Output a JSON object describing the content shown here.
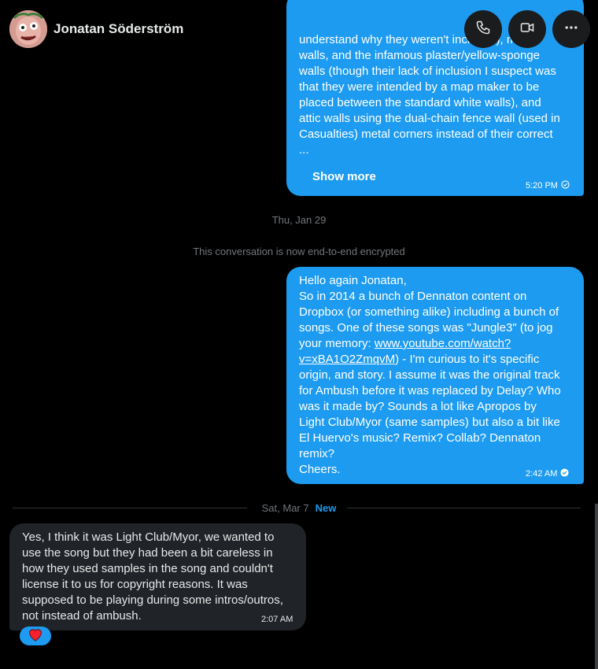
{
  "header": {
    "contact_name": "Jonatan Söderström",
    "avatar_icon": "avatar-illustration",
    "buttons": {
      "call_icon": "phone-icon",
      "video_icon": "video-camera-icon",
      "more_icon": "more-horizontal-icon"
    }
  },
  "messages": [
    {
      "direction": "outgoing",
      "text_partial": "understand why they weren't included), metal\nwalls, and the infamous plaster/yellow-sponge\nwalls (though their lack of inclusion I suspect was\nthat they were intended by a map maker to be\nplaced between the standard white walls), and\nattic walls using the dual-chain fence wall (used in\nCasualties) metal corners instead of their correct\n...",
      "show_more_label": "Show more",
      "time": "5:20 PM",
      "status_icon": "sent-check-icon"
    },
    {
      "direction": "outgoing",
      "text_before_link": "Hello again Jonatan,\nSo in 2014 a bunch of Dennaton content on\nDropbox (or something alike) including a bunch of\nsongs. One of these songs was \"Jungle3\"  (to jog\nyour memory: ",
      "link_text": "www.youtube.com/watch?\nv=xBA1O2ZmqvM",
      "text_after_link": ") - I'm curious to it's specific\norigin, and story. I assume it was the original track\nfor Ambush before it was replaced by Delay? Who\nwas it made by? Sounds a lot like Apropos by\nLight Club/Myor (same samples) but also a bit like\nEl Huervo's music? Remix? Collab? Dennaton\nremix?\nCheers.",
      "time": "2:42 AM",
      "status_icon": "read-check-icon"
    },
    {
      "direction": "incoming",
      "text": "Yes, I think it was Light Club/Myor, we wanted to\nuse the song but they had been a bit careless in\nhow they used samples in the song and couldn't\nlicense it to us for copyright reasons. It was\nsupposed to be playing during some intros/outros,\nnot instead of ambush.",
      "time": "2:07 AM",
      "reaction_icon": "heart-icon"
    }
  ],
  "dividers": {
    "date_1": "Thu, Jan 29",
    "encryption_notice": "This conversation is now end-to-end encrypted",
    "date_2": "Sat, Mar 7",
    "new_label": "New"
  },
  "colors": {
    "background": "#000000",
    "outgoing_bubble": "#1d9bf0",
    "incoming_bubble": "#202327",
    "accent": "#1d9bf0",
    "muted_text": "#71767b",
    "reaction_heart": "#f4212e"
  }
}
